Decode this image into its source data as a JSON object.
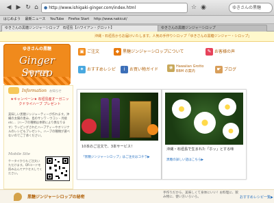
{
  "browser": {
    "url": "http://www.ishigaki-ginger.com/index.html",
    "search_placeholder": "ゆきさんの黒糖",
    "bookmarks": [
      "はじめよう",
      "最新ニュース",
      "YouTube",
      "Firefox Start",
      "http://www.nakicut/"
    ],
    "tabs": [
      "ゆきさんの黒糖ジンジャーシロップ　石垣島【ハワイアン・グロット】",
      "ゆきさんの黒糖ジンジャーシロップ"
    ]
  },
  "site": {
    "top_message": "沖縄・石垣島からお届けいたします。人気の手作りシロップ「ゆきさんの黒糖ジンジャー・シロップ」",
    "logo": {
      "line1": "ゆきさんの黒糖",
      "line2": "Ginger Syrup",
      "line3": "沖縄・石垣島"
    },
    "nav": [
      {
        "label": "ご注文",
        "icon": "bag-icon",
        "color": "#f08a1c"
      },
      {
        "label": "黒糖ジンジャーシロップについて",
        "icon": "gift-icon",
        "color": "#e87a0f"
      },
      {
        "label": "お客様の声",
        "icon": "speech-icon",
        "color": "#e6425a"
      },
      {
        "label": "おすすめレシピ",
        "icon": "bulb-icon",
        "color": "#49a8df"
      },
      {
        "label": "お買い物ガイド",
        "icon": "info-icon",
        "color": "#3c6fb8"
      },
      {
        "label": "Hawaiian Grotto BBM の案内",
        "icon": "hibiscus-icon",
        "color": "#c8a85a"
      },
      {
        "label": "ブログ",
        "icon": "hand-icon",
        "color": "#d89e5a"
      }
    ],
    "sidebar": {
      "info_heading": "Information",
      "info_sub": "お知らせ",
      "campaign": "★キャンペーン★ 石垣島産オーガニックドライハーブ プレゼント",
      "info_text": "美味しい黒糖ジンジャーティーが作れます。沖縄の太陽の恵み、島のサンワ・ウコン・月桃 etc…（ハーブの種類は季節により異なります）ラッピングされたハーブティーやオリジナルのレシピもプレゼント。ハーブの種類が選べないのでご了承ください。",
      "mobile_heading": "Mobile Site",
      "mobile_text": "ケータイからもご注文いただけます。QRコードを読み込んでアクセスしてください。"
    },
    "card1": {
      "caption": "10本のご注文で、3本サービス！",
      "link": "「黒糖ジンジャーシロップ」はご注文はコチラ▶"
    },
    "card2": {
      "caption": "沖縄・石垣島で生まれた「ホッ」とする味",
      "link": "黒糖の詳しい話はこちら▶"
    },
    "bottom": {
      "title": "黒糖ジンジャーシロップの秘密",
      "desc": "手作りだから、美味しくて身体にいい！お料理に、飲み物に、使い方いろいろ。",
      "link": "おすすめレシピ一覧▶"
    }
  }
}
